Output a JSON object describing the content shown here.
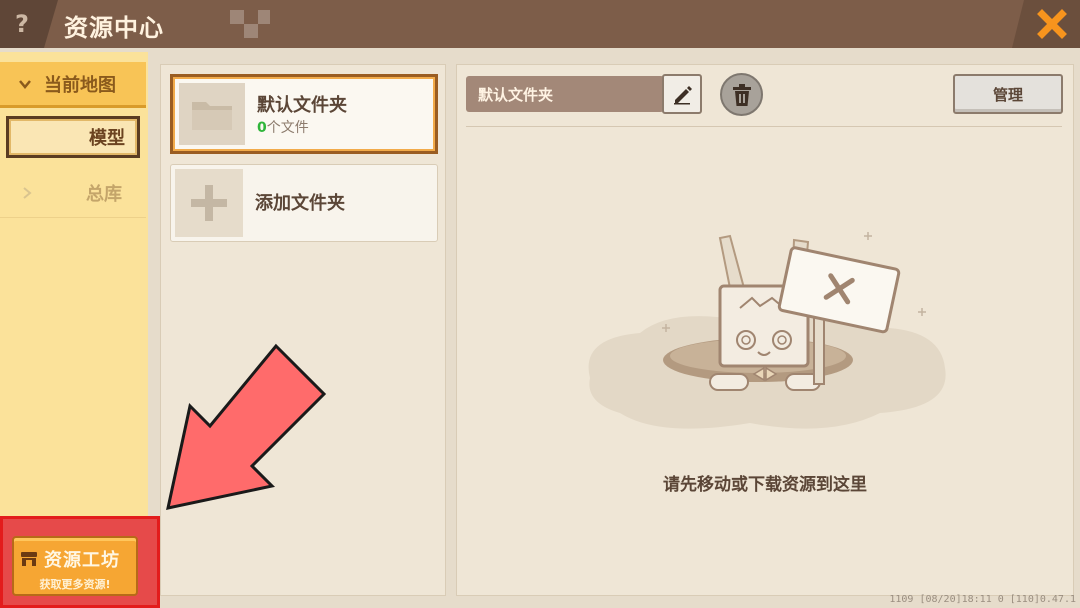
{
  "header": {
    "help_label": "?",
    "title": "资源中心"
  },
  "sidebar": {
    "section_label": "当前地图",
    "selected_item": "模型",
    "items": [
      {
        "label": "总库"
      }
    ]
  },
  "workshop": {
    "title": "资源工坊",
    "subtitle": "获取更多资源!"
  },
  "folders": {
    "default_name": "默认文件夹",
    "count": "0",
    "count_suffix": "个文件",
    "add_label": "添加文件夹"
  },
  "detail": {
    "folder_name": "默认文件夹",
    "manage_label": "管理",
    "empty_message": "请先移动或下载资源到这里"
  },
  "footer": {
    "text": "1109   [08/20]18:11 0   [110]0.47.1"
  },
  "colors": {
    "header_bg": "#7d5d49",
    "sidebar_bg": "#fbe29a",
    "accent_orange": "#f6a633",
    "annotation_red": "#e31c1c",
    "count_green": "#2fb53a"
  }
}
